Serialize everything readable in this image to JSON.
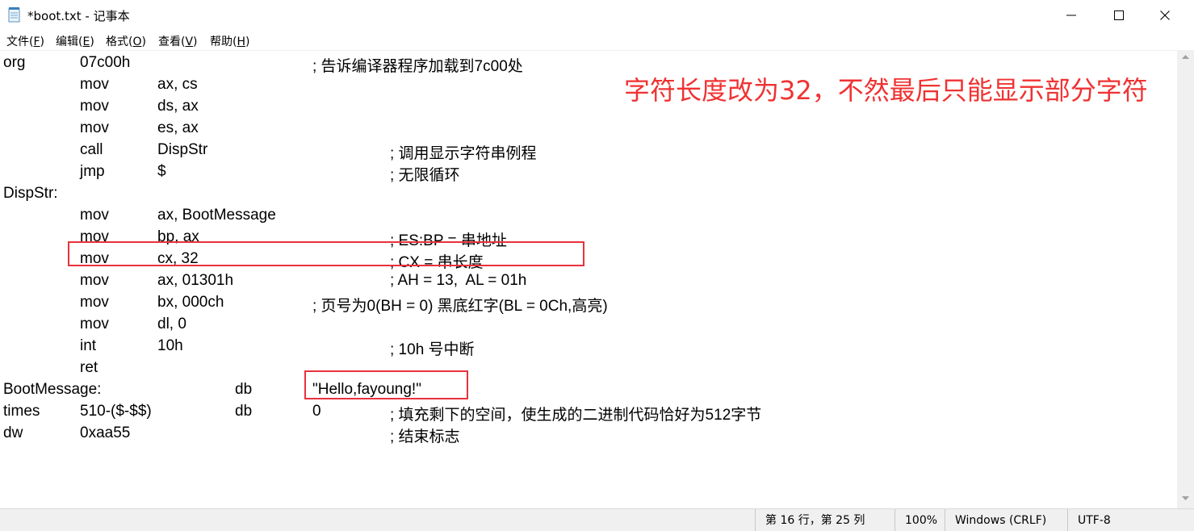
{
  "window": {
    "title": "*boot.txt - 记事本"
  },
  "menu": [
    {
      "label": "文件",
      "key": "F"
    },
    {
      "label": "编辑",
      "key": "E"
    },
    {
      "label": "格式",
      "key": "O"
    },
    {
      "label": "查看",
      "key": "V"
    },
    {
      "label": "帮助",
      "key": "H"
    }
  ],
  "code_lines": [
    {
      "c0": "org",
      "c1": "07c00h",
      "c4": "; 告诉编译器程序加载到7c00处"
    },
    {
      "c1": "mov",
      "c2": "ax, cs"
    },
    {
      "c1": "mov",
      "c2": "ds, ax"
    },
    {
      "c1": "mov",
      "c2": "es, ax"
    },
    {
      "c1": "call",
      "c2": "DispStr",
      "c5": "; 调用显示字符串例程"
    },
    {
      "c1": "jmp",
      "c2": "$",
      "c5": "; 无限循环"
    },
    {
      "c0": "DispStr:"
    },
    {
      "c1": "mov",
      "c2": "ax, BootMessage"
    },
    {
      "c1": "mov",
      "c2": "bp, ax",
      "c5": "; ES:BP = 串地址"
    },
    {
      "c1": "mov",
      "c2": "cx, 32",
      "c5": "; CX = 串长度"
    },
    {
      "c1": "mov",
      "c2": "ax, 01301h",
      "c5": "; AH = 13,  AL = 01h"
    },
    {
      "c1": "mov",
      "c2": "bx, 000ch",
      "c4": "; 页号为0(BH = 0) 黑底红字(BL = 0Ch,高亮)"
    },
    {
      "c1": "mov",
      "c2": "dl, 0"
    },
    {
      "c1": "int",
      "c2": "10h",
      "c5": "; 10h 号中断"
    },
    {
      "c1": "ret"
    },
    {
      "c0": "BootMessage:",
      "c3": "db",
      "c4": "\"Hello,fayoung!\""
    },
    {
      "c0": "times",
      "c1": "510-($-$$)",
      "c3": "db",
      "c4": "0",
      "c5": "; 填充剩下的空间，使生成的二进制代码恰好为512字节"
    },
    {
      "c0": "dw",
      "c1": "0xaa55",
      "c5": "; 结束标志"
    }
  ],
  "annotation": {
    "text": "字符长度改为32，不然最后只能显示部分字符",
    "color": "#f03232"
  },
  "status": {
    "position": "第 16 行，第 25 列",
    "zoom": "100%",
    "line_ending": "Windows (CRLF)",
    "encoding": "UTF-8"
  }
}
